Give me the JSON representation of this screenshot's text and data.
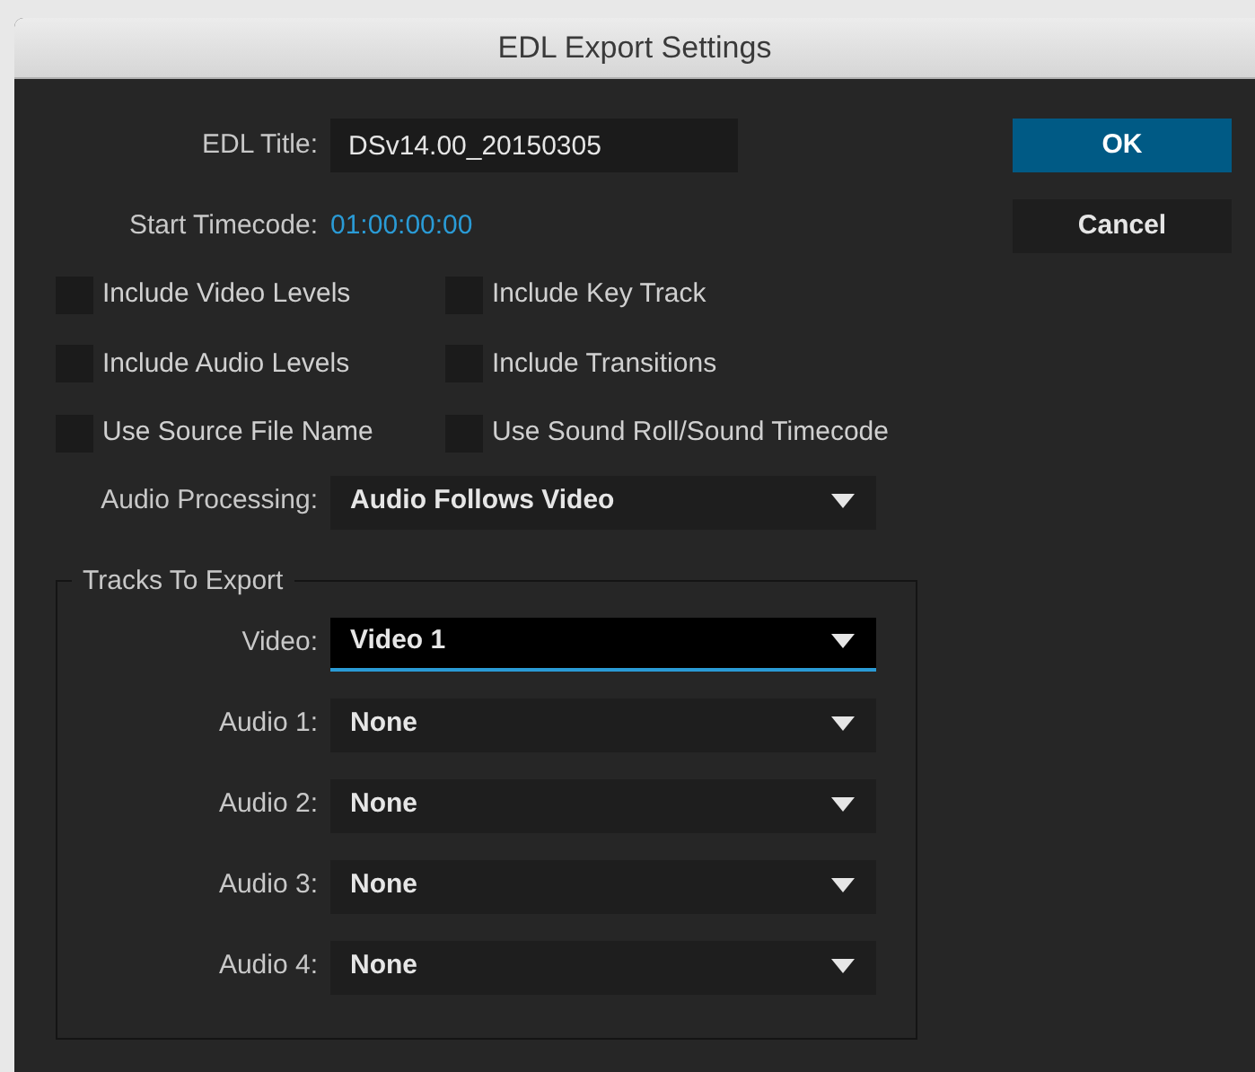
{
  "window": {
    "title": "EDL Export Settings"
  },
  "edl_title": {
    "label": "EDL Title:",
    "value": "DSv14.00_20150305"
  },
  "start_timecode": {
    "label": "Start Timecode:",
    "value": "01:00:00:00"
  },
  "buttons": [
    {
      "label": "OK",
      "kind": "primary"
    },
    {
      "label": "Cancel",
      "kind": "secondary"
    }
  ],
  "checkboxes": [
    {
      "label": "Include Video Levels",
      "checked": false
    },
    {
      "label": "Include Key Track",
      "checked": false
    },
    {
      "label": "Include Audio Levels",
      "checked": false
    },
    {
      "label": "Include Transitions",
      "checked": false
    },
    {
      "label": "Use Source File Name",
      "checked": false
    },
    {
      "label": "Use Sound Roll/Sound Timecode",
      "checked": false
    }
  ],
  "audio_processing": {
    "label": "Audio Processing:",
    "value": "Audio Follows Video"
  },
  "tracks_to_export": {
    "title": "Tracks To Export",
    "tracks": [
      {
        "label": "Video:",
        "value": "Video 1",
        "focused": true
      },
      {
        "label": "Audio 1:",
        "value": "None",
        "focused": false
      },
      {
        "label": "Audio 2:",
        "value": "None",
        "focused": false
      },
      {
        "label": "Audio 3:",
        "value": "None",
        "focused": false
      },
      {
        "label": "Audio 4:",
        "value": "None",
        "focused": false
      }
    ]
  }
}
